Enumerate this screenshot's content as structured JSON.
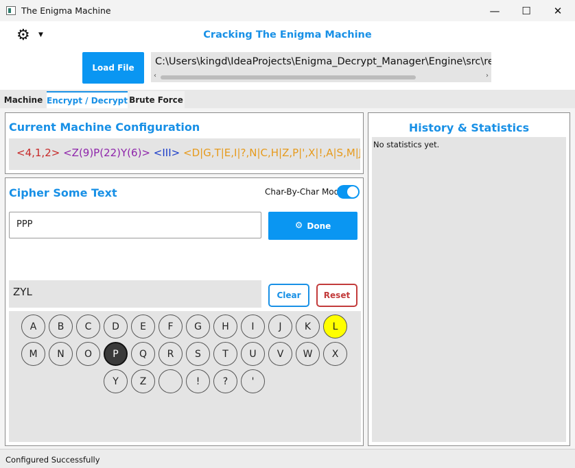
{
  "window": {
    "title": "The Enigma Machine",
    "minimize": "—",
    "maximize": "☐",
    "close": "✕"
  },
  "header": {
    "settings_icon": "gear-icon",
    "heading": "Cracking The Enigma Machine",
    "load_file_label": "Load File",
    "file_path": "C:\\Users\\kingd\\IdeaProjects\\Enigma_Decrypt_Manager\\Engine\\src\\resources\\"
  },
  "tabs": [
    {
      "label": "Machine"
    },
    {
      "label": "Encrypt / Decrypt"
    },
    {
      "label": "Brute Force"
    }
  ],
  "config": {
    "title": "Current Machine Configuration",
    "rotors": "<4,1,2>",
    "positions": "<Z(9)P(22)Y(6)>",
    "reflector": "<III>",
    "plugboard": "<D|G,T|E,I|?,N|C,H|Z,P|',X|!,A|S,M|J,",
    "colors": {
      "rotors": "#c62828",
      "positions": "#8e24aa",
      "reflector": "#1a3cc8",
      "plugboard": "#e69a1c"
    }
  },
  "cipher": {
    "title": "Cipher Some Text",
    "mode_label": "Char-By-Char Mode",
    "mode_on": true,
    "input_value": "PPP",
    "done_label": "Done",
    "output_value": "ZYL",
    "clear_label": "Clear",
    "reset_label": "Reset"
  },
  "keyboard": {
    "rows": [
      [
        "A",
        "B",
        "C",
        "D",
        "E",
        "F",
        "G",
        "H",
        "I",
        "J",
        "K",
        "L"
      ],
      [
        "M",
        "N",
        "O",
        "P",
        "Q",
        "R",
        "S",
        "T",
        "U",
        "V",
        "W",
        "X"
      ],
      [
        "Y",
        "Z",
        " ",
        "!",
        "?",
        "'"
      ]
    ],
    "lit_key": "L",
    "pressed_key": "P"
  },
  "history": {
    "title": "History & Statistics",
    "empty_text": "No statistics yet."
  },
  "status": {
    "text": "Configured Successfully"
  }
}
